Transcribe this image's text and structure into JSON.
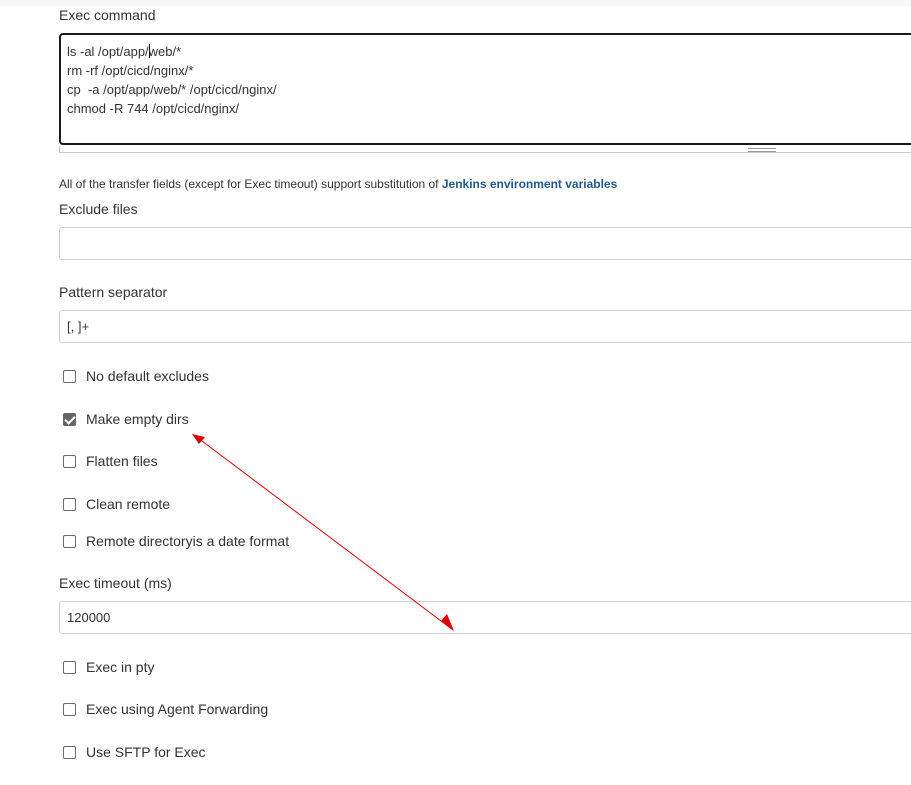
{
  "exec_command": {
    "label": "Exec command",
    "lines": [
      "ls -al /opt/app/web/*",
      "rm -rf /opt/cicd/nginx/*",
      "cp  -a /opt/app/web/* /opt/cicd/nginx/",
      "chmod -R 744 /opt/cicd/nginx/"
    ]
  },
  "help": {
    "text": "All of the transfer fields (except for Exec timeout) support substitution of ",
    "link": "Jenkins environment variables"
  },
  "exclude_files": {
    "label": "Exclude files",
    "value": ""
  },
  "pattern_separator": {
    "label": "Pattern separator",
    "value": "[, ]+"
  },
  "checkboxes_group1": [
    {
      "label": "No default excludes",
      "checked": false
    },
    {
      "label": "Make empty dirs",
      "checked": true
    },
    {
      "label": "Flatten files",
      "checked": false
    },
    {
      "label": "Clean remote",
      "checked": false
    },
    {
      "label": "Remote directoryis a date format",
      "checked": false
    }
  ],
  "exec_timeout": {
    "label": "Exec timeout (ms)",
    "value": "120000"
  },
  "checkboxes_group2": [
    {
      "label": "Exec in pty",
      "checked": false
    },
    {
      "label": "Exec using Agent Forwarding",
      "checked": false
    },
    {
      "label": "Use SFTP for Exec",
      "checked": false
    }
  ],
  "colors": {
    "link": "#1f5b8e",
    "annotation_arrow": "#e00000",
    "checkbox_checked": "#666666"
  },
  "icons": {
    "annotation": "double-headed-arrow-icon",
    "resize": "resize-grip-icon"
  }
}
